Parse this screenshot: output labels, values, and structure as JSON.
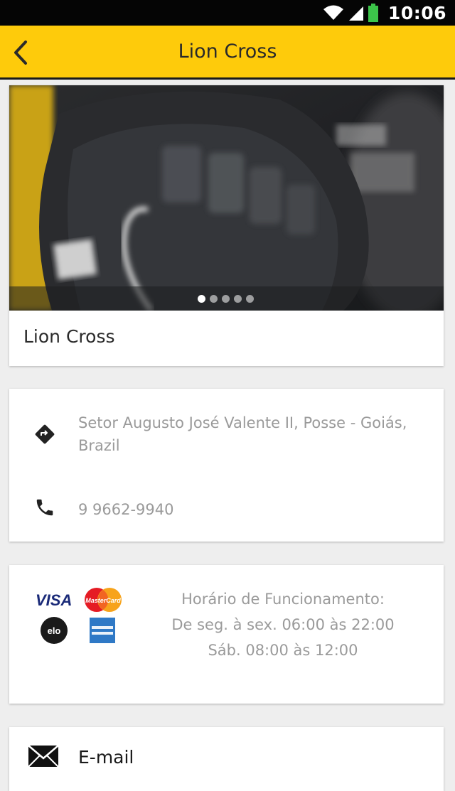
{
  "status_bar": {
    "time": "10:06",
    "icons": [
      "wifi-icon",
      "signal-icon",
      "battery-icon"
    ]
  },
  "app_bar": {
    "title": "Lion Cross",
    "back_icon": "back-arrow-icon"
  },
  "gallery": {
    "slides": 5,
    "active_index": 0
  },
  "business": {
    "name": "Lion Cross"
  },
  "contact": {
    "address": "Setor Augusto José Valente II, Posse - Goiás, Brazil",
    "phone": "9 9662-9940"
  },
  "payment": {
    "cards": [
      "visa-card-icon",
      "mastercard-card-icon",
      "elo-card-icon",
      "amex-card-icon"
    ],
    "visa_label": "VISA",
    "mastercard_label": "MasterCard",
    "elo_label": "elo"
  },
  "hours": {
    "title": "Horário de Funcionamento:",
    "weekdays": "De seg. à sex. 06:00 às 22:00",
    "saturday": "Sáb. 08:00 às 12:00"
  },
  "email": {
    "label": "E-mail"
  },
  "colors": {
    "accent": "#fecb0b",
    "status_bar": "#050505",
    "text_muted": "#9a9a9a"
  }
}
